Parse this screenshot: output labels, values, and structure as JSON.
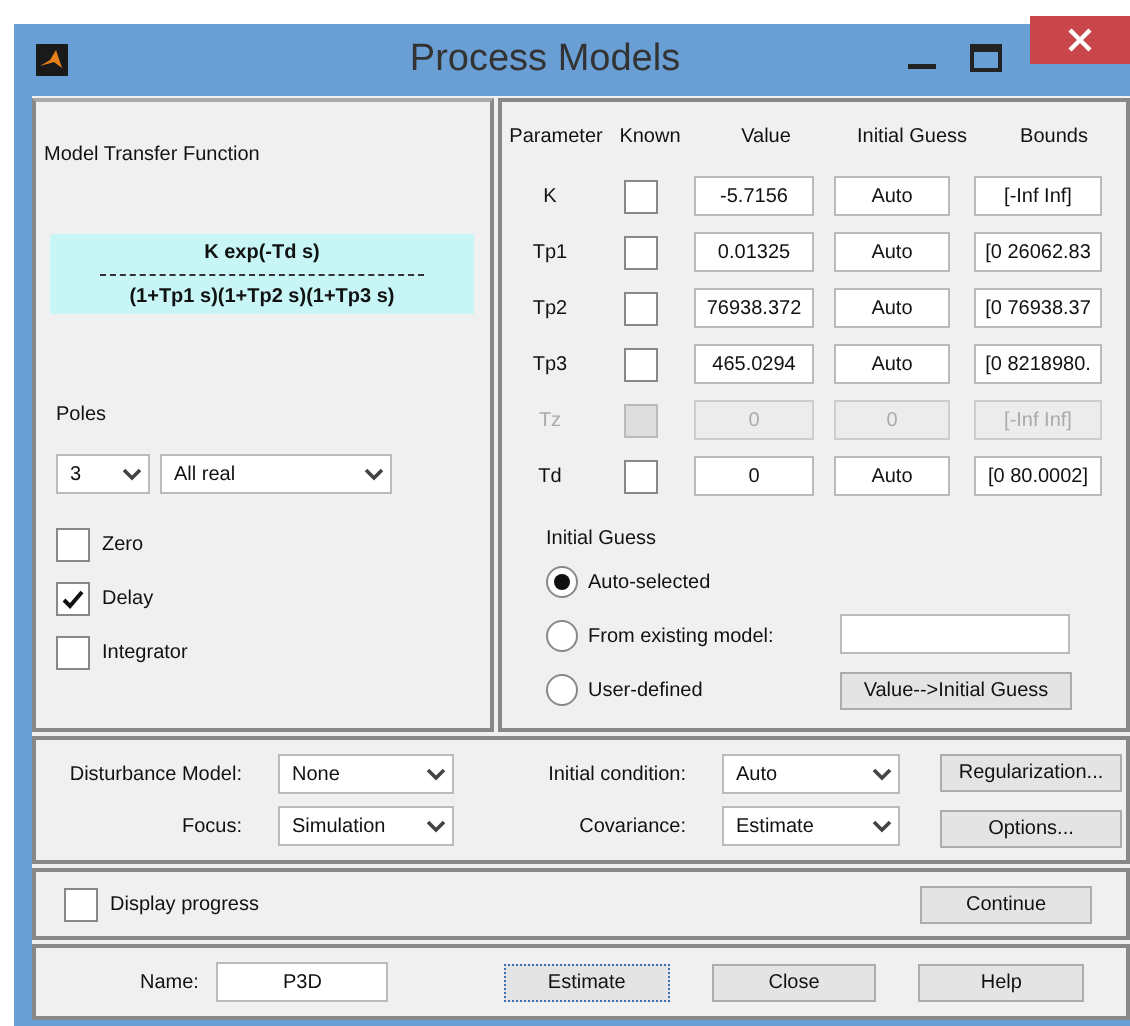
{
  "window": {
    "title": "Process Models"
  },
  "model_panel": {
    "title": "Model Transfer Function",
    "numerator": "K exp(-Td s)",
    "denominator": "(1+Tp1 s)(1+Tp2 s)(1+Tp3 s)",
    "poles_label": "Poles",
    "poles_count": "3",
    "poles_type": "All real",
    "options": [
      {
        "label": "Zero",
        "checked": false
      },
      {
        "label": "Delay",
        "checked": true
      },
      {
        "label": "Integrator",
        "checked": false
      }
    ]
  },
  "parameters": {
    "columns": [
      "Parameter",
      "Known",
      "Value",
      "Initial Guess",
      "Bounds"
    ],
    "rows": [
      {
        "name": "K",
        "known": false,
        "disabled": false,
        "value": "-5.7156",
        "initial_guess": "Auto",
        "bounds": "[-Inf Inf]"
      },
      {
        "name": "Tp1",
        "known": false,
        "disabled": false,
        "value": "0.01325",
        "initial_guess": "Auto",
        "bounds": "[0 26062.83"
      },
      {
        "name": "Tp2",
        "known": false,
        "disabled": false,
        "value": "76938.372",
        "initial_guess": "Auto",
        "bounds": "[0 76938.37"
      },
      {
        "name": "Tp3",
        "known": false,
        "disabled": false,
        "value": "465.0294",
        "initial_guess": "Auto",
        "bounds": "[0 8218980."
      },
      {
        "name": "Tz",
        "known": false,
        "disabled": true,
        "value": "0",
        "initial_guess": "0",
        "bounds": "[-Inf Inf]"
      },
      {
        "name": "Td",
        "known": false,
        "disabled": false,
        "value": "0",
        "initial_guess": "Auto",
        "bounds": "[0 80.0002]"
      }
    ]
  },
  "initial_guess": {
    "title": "Initial Guess",
    "options": [
      {
        "label": "Auto-selected",
        "selected": true
      },
      {
        "label": "From existing model:",
        "selected": false
      },
      {
        "label": "User-defined",
        "selected": false
      }
    ],
    "button": "Value-->Initial Guess"
  },
  "settings": {
    "disturbance_model": {
      "label": "Disturbance Model:",
      "value": "None"
    },
    "focus": {
      "label": "Focus:",
      "value": "Simulation"
    },
    "initial_condition": {
      "label": "Initial condition:",
      "value": "Auto"
    },
    "covariance": {
      "label": "Covariance:",
      "value": "Estimate"
    },
    "buttons": [
      "Regularization...",
      "Options..."
    ]
  },
  "progress": {
    "label": "Display progress",
    "checked": false,
    "button": "Continue"
  },
  "footer": {
    "name_label": "Name:",
    "name_value": "P3D",
    "buttons": [
      {
        "label": "Estimate",
        "focused": true
      },
      {
        "label": "Close",
        "focused": false
      },
      {
        "label": "Help",
        "focused": false
      }
    ]
  }
}
